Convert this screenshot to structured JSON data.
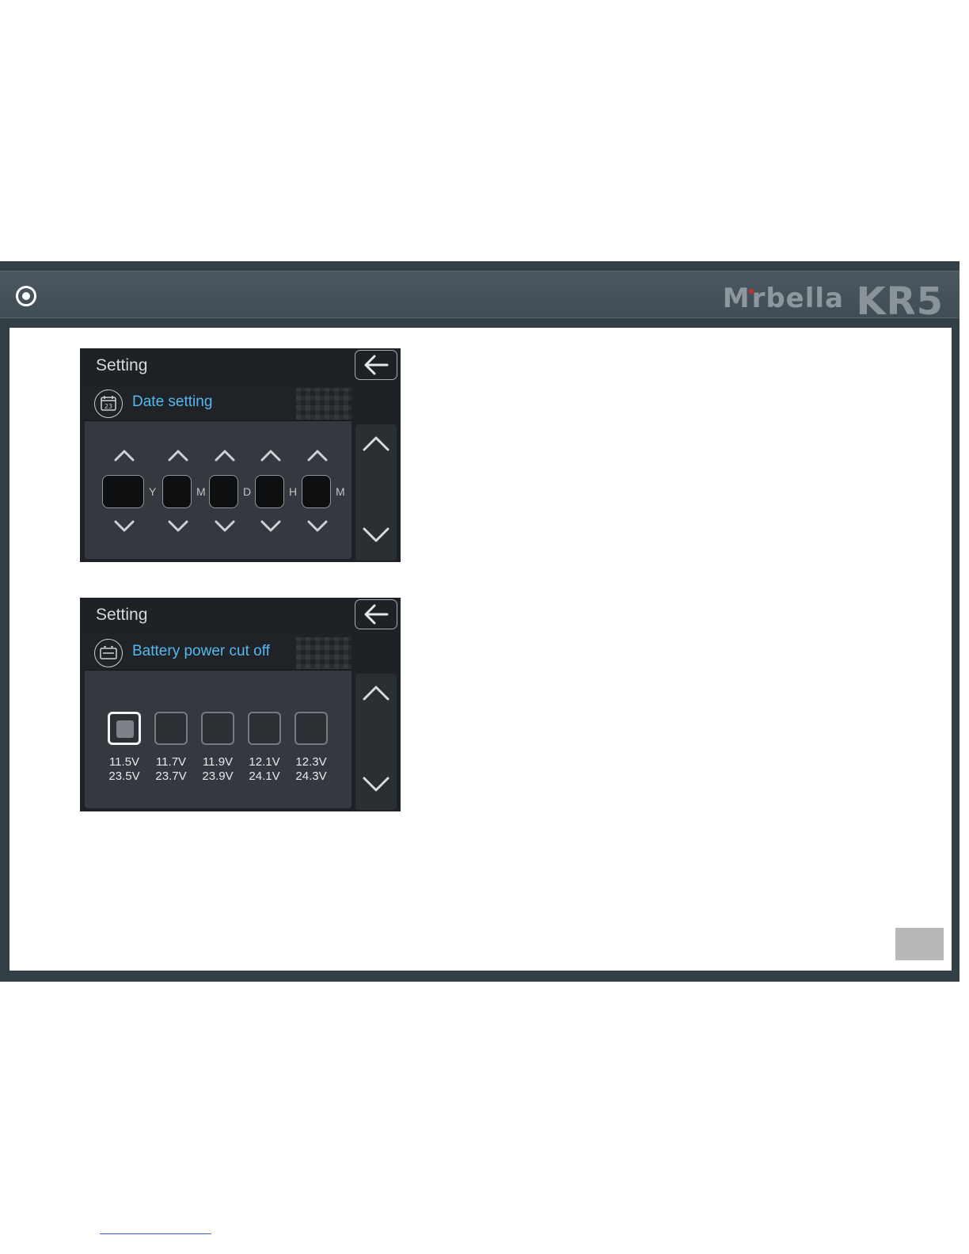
{
  "header": {
    "brand": "Morbella",
    "model": "KR5"
  },
  "screen_date": {
    "title": "Setting",
    "panel_title": "Date setting",
    "icon_text": "23",
    "fields": [
      {
        "unit": "Y"
      },
      {
        "unit": "M"
      },
      {
        "unit": "D"
      },
      {
        "unit": "H"
      },
      {
        "unit": "M"
      }
    ]
  },
  "screen_battery": {
    "title": "Setting",
    "panel_title": "Battery power cut off",
    "selected_index": 0,
    "options": [
      {
        "v12": "11.5V",
        "v24": "23.5V"
      },
      {
        "v12": "11.7V",
        "v24": "23.7V"
      },
      {
        "v12": "11.9V",
        "v24": "23.9V"
      },
      {
        "v12": "12.1V",
        "v24": "24.1V"
      },
      {
        "v12": "12.3V",
        "v24": "24.3V"
      }
    ]
  },
  "colors": {
    "accent": "#55b8ef",
    "frame": "#333e45",
    "screen_bg": "#1e2226"
  }
}
